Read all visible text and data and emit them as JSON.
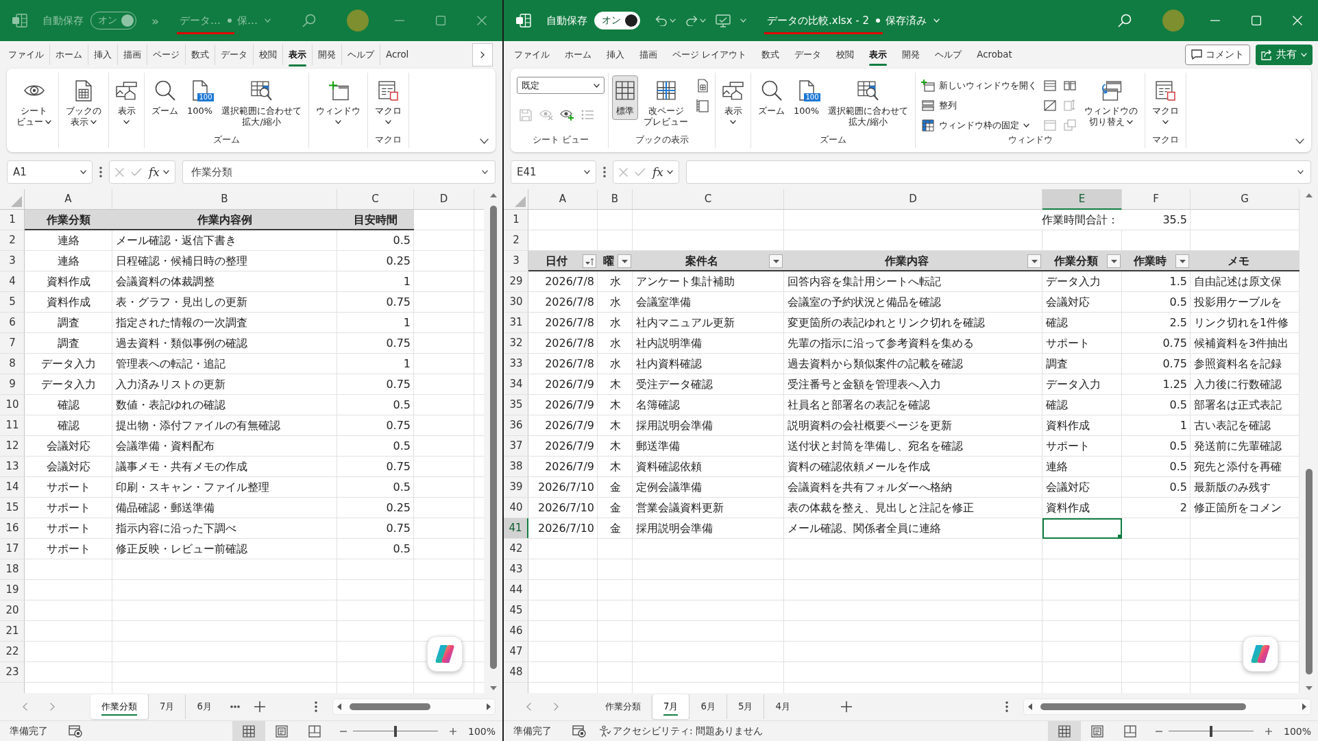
{
  "windows": [
    {
      "active": false,
      "title_bar": {
        "autosave_label": "自動保存",
        "autosave_toggle": {
          "label": "オン",
          "on": true
        },
        "more_commands": "»",
        "file_name": "データ…",
        "save_status": "保…",
        "annotated": true
      },
      "ribbon_tabs": [
        {
          "label": "ファイル",
          "selected": false
        },
        {
          "label": "ホーム",
          "selected": false
        },
        {
          "label": "挿入",
          "selected": false
        },
        {
          "label": "描画",
          "selected": false
        },
        {
          "label": "ページ",
          "selected": false
        },
        {
          "label": "数式",
          "selected": false
        },
        {
          "label": "データ",
          "selected": false
        },
        {
          "label": "校閲",
          "selected": false
        },
        {
          "label": "表示",
          "selected": true
        },
        {
          "label": "開発",
          "selected": false
        },
        {
          "label": "ヘルプ",
          "selected": false
        },
        {
          "label": "Acrol",
          "selected": false
        }
      ],
      "tab_overflow": true,
      "ribbon_groups": [
        {
          "items": [
            {
              "kind": "sheetview",
              "lines": [
                "シート",
                "ビュー"
              ],
              "dropdown": true
            }
          ]
        },
        {
          "items": [
            {
              "kind": "bookview",
              "lines": [
                "ブックの",
                "表示"
              ],
              "dropdown": true
            }
          ]
        },
        {
          "items": [
            {
              "kind": "show",
              "lines": [
                "表示"
              ],
              "dropdown": true
            }
          ]
        },
        {
          "label": "ズーム",
          "items": [
            {
              "kind": "zoom",
              "lines": [
                "ズーム"
              ]
            },
            {
              "kind": "zoom100",
              "lines": [
                "100%"
              ],
              "badge": "100"
            },
            {
              "kind": "fitselection",
              "lines": [
                "選択範囲に合わせて",
                "拡大/縮小"
              ]
            }
          ]
        },
        {
          "items": [
            {
              "kind": "window",
              "lines": [
                "ウィンドウ"
              ],
              "dropdown": true
            }
          ]
        },
        {
          "label": "マクロ",
          "items": [
            {
              "kind": "macro",
              "lines": [
                "マクロ"
              ],
              "dropdown": true
            }
          ]
        }
      ],
      "formula_bar": {
        "name_box": "A1",
        "function_button": "fx",
        "formula": "作業分類"
      },
      "sheet": {
        "kind": "reference",
        "columns": [
          {
            "letter": "A",
            "selected": false
          },
          {
            "letter": "B",
            "selected": false
          },
          {
            "letter": "C",
            "selected": false
          },
          {
            "letter": "D",
            "selected": false
          }
        ],
        "rows": [
          {
            "number": "1",
            "selected": false,
            "kind": "header",
            "headers": [
              {
                "text": "作業分類"
              },
              {
                "text": "作業内容例"
              },
              {
                "text": "目安時間"
              }
            ]
          },
          {
            "number": "2",
            "selected": false,
            "kind": "data",
            "category": "連絡",
            "example": "メール確認・返信下書き",
            "hours": "0.5"
          },
          {
            "number": "3",
            "selected": false,
            "kind": "data",
            "category": "連絡",
            "example": "日程確認・候補日時の整理",
            "hours": "0.25"
          },
          {
            "number": "4",
            "selected": false,
            "kind": "data",
            "category": "資料作成",
            "example": "会議資料の体裁調整",
            "hours": "1"
          },
          {
            "number": "5",
            "selected": false,
            "kind": "data",
            "category": "資料作成",
            "example": "表・グラフ・見出しの更新",
            "hours": "0.75"
          },
          {
            "number": "6",
            "selected": false,
            "kind": "data",
            "category": "調査",
            "example": "指定された情報の一次調査",
            "hours": "1"
          },
          {
            "number": "7",
            "selected": false,
            "kind": "data",
            "category": "調査",
            "example": "過去資料・類似事例の確認",
            "hours": "0.75"
          },
          {
            "number": "8",
            "selected": false,
            "kind": "data",
            "category": "データ入力",
            "example": "管理表への転記・追記",
            "hours": "1"
          },
          {
            "number": "9",
            "selected": false,
            "kind": "data",
            "category": "データ入力",
            "example": "入力済みリストの更新",
            "hours": "0.75"
          },
          {
            "number": "10",
            "selected": false,
            "kind": "data",
            "category": "確認",
            "example": "数値・表記ゆれの確認",
            "hours": "0.5"
          },
          {
            "number": "11",
            "selected": false,
            "kind": "data",
            "category": "確認",
            "example": "提出物・添付ファイルの有無確認",
            "hours": "0.75"
          },
          {
            "number": "12",
            "selected": false,
            "kind": "data",
            "category": "会議対応",
            "example": "会議準備・資料配布",
            "hours": "0.5"
          },
          {
            "number": "13",
            "selected": false,
            "kind": "data",
            "category": "会議対応",
            "example": "議事メモ・共有メモの作成",
            "hours": "0.75"
          },
          {
            "number": "14",
            "selected": false,
            "kind": "data",
            "category": "サポート",
            "example": "印刷・スキャン・ファイル整理",
            "hours": "0.5"
          },
          {
            "number": "15",
            "selected": false,
            "kind": "data",
            "category": "サポート",
            "example": "備品確認・郵送準備",
            "hours": "0.25"
          },
          {
            "number": "16",
            "selected": false,
            "kind": "data",
            "category": "サポート",
            "example": "指示内容に沿った下調べ",
            "hours": "0.75"
          },
          {
            "number": "17",
            "selected": false,
            "kind": "data",
            "category": "サポート",
            "example": "修正反映・レビュー前確認",
            "hours": "0.5"
          },
          {
            "number": "18",
            "selected": false,
            "kind": "blank"
          },
          {
            "number": "19",
            "selected": false,
            "kind": "blank"
          },
          {
            "number": "20",
            "selected": false,
            "kind": "blank"
          },
          {
            "number": "21",
            "selected": false,
            "kind": "blank"
          },
          {
            "number": "22",
            "selected": false,
            "kind": "blank"
          },
          {
            "number": "23",
            "selected": false,
            "kind": "blank"
          }
        ]
      },
      "sheet_tabs": [
        {
          "label": "作業分類",
          "selected": true
        },
        {
          "label": "7月",
          "selected": false
        },
        {
          "label": "6月",
          "selected": false
        }
      ],
      "more_sheets": true,
      "status_bar": {
        "status": "準備完了",
        "views": [
          {
            "kind": "normal",
            "selected": true
          },
          {
            "kind": "pagelayout",
            "selected": false
          },
          {
            "kind": "pagebreak",
            "selected": false
          }
        ],
        "zoom": {
          "level": 0.5,
          "reading": "100%"
        }
      }
    },
    {
      "active": true,
      "title_bar": {
        "autosave_label": "自動保存",
        "autosave_toggle": {
          "label": "オン",
          "on": true
        },
        "quick_access": true,
        "file_name": "データの比較.xlsx - 2",
        "save_status": "保存済み",
        "annotated": true
      },
      "ribbon_tabs": [
        {
          "label": "ファイル",
          "selected": false
        },
        {
          "label": "ホーム",
          "selected": false
        },
        {
          "label": "挿入",
          "selected": false
        },
        {
          "label": "描画",
          "selected": false
        },
        {
          "label": "ページ レイアウト",
          "selected": false
        },
        {
          "label": "数式",
          "selected": false
        },
        {
          "label": "データ",
          "selected": false
        },
        {
          "label": "校閲",
          "selected": false
        },
        {
          "label": "表示",
          "selected": true
        },
        {
          "label": "開発",
          "selected": false
        },
        {
          "label": "ヘルプ",
          "selected": false
        },
        {
          "label": "Acrobat",
          "selected": false
        }
      ],
      "comment_button": "コメント",
      "share_button": "共有",
      "ribbon_groups": [
        {
          "label": "シート ビュー",
          "items": [
            {
              "kind": "stack",
              "items": [
                {
                  "kind": "viewselect",
                  "value": "既定"
                },
                {
                  "kind": "iconrow",
                  "items": [
                    {
                      "kind": "saveview",
                      "disabled": true
                    },
                    {
                      "kind": "exitview",
                      "disabled": true
                    },
                    {
                      "kind": "newview",
                      "disabled": false
                    },
                    {
                      "kind": "viewoptions",
                      "disabled": true
                    }
                  ]
                }
              ]
            }
          ]
        },
        {
          "label": "ブックの表示",
          "items": [
            {
              "kind": "normal",
              "lines": [
                "標準"
              ],
              "selected": true
            },
            {
              "kind": "pagebreak",
              "lines": [
                "改ページ",
                "プレビュー"
              ],
              "selected": false
            },
            {
              "kind": "stack",
              "items": [
                {
                  "kind": "pagelayout",
                  "selected": false
                },
                {
                  "kind": "customviews"
                }
              ]
            }
          ]
        },
        {
          "items": [
            {
              "kind": "show",
              "lines": [
                "表示"
              ],
              "dropdown": true
            }
          ]
        },
        {
          "label": "ズーム",
          "items": [
            {
              "kind": "zoom",
              "lines": [
                "ズーム"
              ]
            },
            {
              "kind": "zoom100",
              "lines": [
                "100%"
              ],
              "badge": "100"
            },
            {
              "kind": "fitselection",
              "lines": [
                "選択範囲に合わせて",
                "拡大/縮小"
              ]
            }
          ]
        },
        {
          "label": "ウィンドウ",
          "items": [
            {
              "kind": "stack",
              "items": [
                {
                  "kind": "newwindow",
                  "label": "新しいウィンドウを開く"
                },
                {
                  "kind": "arrange",
                  "label": "整列"
                },
                {
                  "kind": "freeze",
                  "label": "ウィンドウ枠の固定",
                  "dropdown": true
                }
              ]
            },
            {
              "kind": "stack",
              "items": [
                {
                  "kind": "split",
                  "disabled": false
                },
                {
                  "kind": "hide",
                  "disabled": false
                },
                {
                  "kind": "unhide",
                  "disabled": true
                }
              ]
            },
            {
              "kind": "stack",
              "items": [
                {
                  "kind": "sidebyside",
                  "disabled": false
                },
                {
                  "kind": "syncscroll",
                  "disabled": true
                },
                {
                  "kind": "resetposition",
                  "disabled": true
                }
              ]
            },
            {
              "kind": "switchwindows",
              "lines": [
                "ウィンドウの",
                "切り替え"
              ],
              "dropdown": true
            }
          ]
        },
        {
          "label": "マクロ",
          "items": [
            {
              "kind": "macro",
              "lines": [
                "マクロ"
              ],
              "dropdown": true
            }
          ]
        }
      ],
      "formula_bar": {
        "name_box": "E41",
        "function_button": "fx"
      },
      "sheet": {
        "kind": "log",
        "columns": [
          {
            "letter": "A",
            "selected": false
          },
          {
            "letter": "B",
            "selected": false
          },
          {
            "letter": "C",
            "selected": false
          },
          {
            "letter": "D",
            "selected": false
          },
          {
            "letter": "E",
            "selected": true
          },
          {
            "letter": "F",
            "selected": false
          },
          {
            "letter": "G",
            "selected": false
          }
        ],
        "rows": [
          {
            "number": "1",
            "selected": false,
            "kind": "total",
            "label": "作業時間合計：",
            "value": "35.5"
          },
          {
            "number": "2",
            "selected": false,
            "kind": "blank"
          },
          {
            "number": "3",
            "selected": false,
            "kind": "header",
            "headers": [
              {
                "text": "日付",
                "filter": true,
                "sorted": true
              },
              {
                "text": "曜",
                "filter": true,
                "sorted": false
              },
              {
                "text": "案件名",
                "filter": true,
                "sorted": false
              },
              {
                "text": "作業内容",
                "filter": true,
                "sorted": false
              },
              {
                "text": "作業分類",
                "filter": true,
                "sorted": false
              },
              {
                "text": "作業時",
                "filter": true,
                "sorted": false
              },
              {
                "text": "メモ",
                "filter": false
              }
            ]
          },
          {
            "number": "29",
            "selected": false,
            "kind": "data",
            "date": "2026/7/8",
            "day": "水",
            "project": "アンケート集計補助",
            "task": "回答内容を集計用シートへ転記",
            "category": "データ入力",
            "hours": "1.5",
            "memo": "自由記述は原文保"
          },
          {
            "number": "30",
            "selected": false,
            "kind": "data",
            "date": "2026/7/8",
            "day": "水",
            "project": "会議室準備",
            "task": "会議室の予約状況と備品を確認",
            "category": "会議対応",
            "hours": "0.5",
            "memo": "投影用ケーブルを"
          },
          {
            "number": "31",
            "selected": false,
            "kind": "data",
            "date": "2026/7/8",
            "day": "水",
            "project": "社内マニュアル更新",
            "task": "変更箇所の表記ゆれとリンク切れを確認",
            "category": "確認",
            "hours": "2.5",
            "memo": "リンク切れを1件修"
          },
          {
            "number": "32",
            "selected": false,
            "kind": "data",
            "date": "2026/7/8",
            "day": "水",
            "project": "社内説明準備",
            "task": "先輩の指示に沿って参考資料を集める",
            "category": "サポート",
            "hours": "0.75",
            "memo": "候補資料を3件抽出"
          },
          {
            "number": "33",
            "selected": false,
            "kind": "data",
            "date": "2026/7/8",
            "day": "水",
            "project": "社内資料確認",
            "task": "過去資料から類似案件の記載を確認",
            "category": "調査",
            "hours": "0.75",
            "memo": "参照資料名を記録"
          },
          {
            "number": "34",
            "selected": false,
            "kind": "data",
            "date": "2026/7/9",
            "day": "木",
            "project": "受注データ確認",
            "task": "受注番号と金額を管理表へ入力",
            "category": "データ入力",
            "hours": "1.25",
            "memo": "入力後に行数確認"
          },
          {
            "number": "35",
            "selected": false,
            "kind": "data",
            "date": "2026/7/9",
            "day": "木",
            "project": "名簿確認",
            "task": "社員名と部署名の表記を確認",
            "category": "確認",
            "hours": "0.5",
            "memo": "部署名は正式表記"
          },
          {
            "number": "36",
            "selected": false,
            "kind": "data",
            "date": "2026/7/9",
            "day": "木",
            "project": "採用説明会準備",
            "task": "説明資料の会社概要ページを更新",
            "category": "資料作成",
            "hours": "1",
            "memo": "古い表記を確認"
          },
          {
            "number": "37",
            "selected": false,
            "kind": "data",
            "date": "2026/7/9",
            "day": "木",
            "project": "郵送準備",
            "task": "送付状と封筒を準備し、宛名を確認",
            "category": "サポート",
            "hours": "0.5",
            "memo": "発送前に先輩確認"
          },
          {
            "number": "38",
            "selected": false,
            "kind": "data",
            "date": "2026/7/9",
            "day": "木",
            "project": "資料確認依頼",
            "task": "資料の確認依頼メールを作成",
            "category": "連絡",
            "hours": "0.5",
            "memo": "宛先と添付を再確"
          },
          {
            "number": "39",
            "selected": false,
            "kind": "data",
            "date": "2026/7/10",
            "day": "金",
            "project": "定例会議準備",
            "task": "会議資料を共有フォルダーへ格納",
            "category": "会議対応",
            "hours": "0.5",
            "memo": "最新版のみ残す"
          },
          {
            "number": "40",
            "selected": false,
            "kind": "data",
            "date": "2026/7/10",
            "day": "金",
            "project": "営業会議資料更新",
            "task": "表の体裁を整え、見出しと注記を修正",
            "category": "資料作成",
            "hours": "2",
            "memo": "修正箇所をコメン"
          },
          {
            "number": "41",
            "selected": true,
            "kind": "data",
            "date": "2026/7/10",
            "day": "金",
            "project": "採用説明会準備",
            "task": "メール確認、関係者全員に連絡"
          },
          {
            "number": "42",
            "selected": false,
            "kind": "blank"
          },
          {
            "number": "43",
            "selected": false,
            "kind": "blank"
          },
          {
            "number": "44",
            "selected": false,
            "kind": "blank"
          },
          {
            "number": "45",
            "selected": false,
            "kind": "blank"
          },
          {
            "number": "46",
            "selected": false,
            "kind": "blank"
          },
          {
            "number": "47",
            "selected": false,
            "kind": "blank"
          },
          {
            "number": "48",
            "selected": false,
            "kind": "blank"
          }
        ]
      },
      "sheet_tabs": [
        {
          "label": "作業分類",
          "selected": false
        },
        {
          "label": "7月",
          "selected": true
        },
        {
          "label": "6月",
          "selected": false
        },
        {
          "label": "5月",
          "selected": false
        },
        {
          "label": "4月",
          "selected": false
        }
      ],
      "status_bar": {
        "status": "準備完了",
        "accessibility": "アクセシビリティ: 問題ありません",
        "views": [
          {
            "kind": "normal",
            "selected": true
          },
          {
            "kind": "pagelayout",
            "selected": false
          },
          {
            "kind": "pagebreak",
            "selected": false
          }
        ],
        "zoom": {
          "level": 0.5,
          "reading": "100%"
        }
      }
    }
  ]
}
